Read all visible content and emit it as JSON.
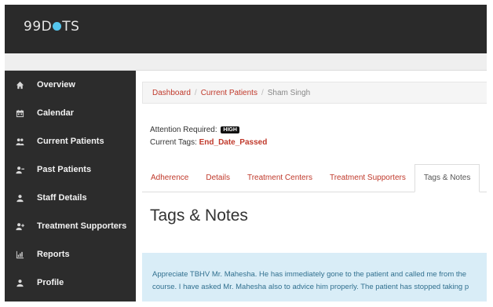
{
  "app": {
    "brand_prefix": "99D",
    "brand_suffix": "TS",
    "logo_dot_color": "#55c6ee"
  },
  "sidebar": {
    "items": [
      {
        "label": "Overview",
        "icon": "home-icon"
      },
      {
        "label": "Calendar",
        "icon": "calendar-icon"
      },
      {
        "label": "Current Patients",
        "icon": "users-icon"
      },
      {
        "label": "Past Patients",
        "icon": "user-minus-icon"
      },
      {
        "label": "Staff Details",
        "icon": "user-icon"
      },
      {
        "label": "Treatment Supporters",
        "icon": "user-plus-icon"
      },
      {
        "label": "Reports",
        "icon": "bar-chart-icon"
      },
      {
        "label": "Profile",
        "icon": "user-icon"
      }
    ]
  },
  "breadcrumb": {
    "items": [
      "Dashboard",
      "Current Patients"
    ],
    "current": "Sham Singh",
    "separator": "/"
  },
  "attention": {
    "label": "Attention Required:",
    "badge": "HIGH"
  },
  "tags": {
    "label": "Current Tags:",
    "value": "End_Date_Passed"
  },
  "tabs": [
    {
      "label": "Adherence",
      "active": false
    },
    {
      "label": "Details",
      "active": false
    },
    {
      "label": "Treatment Centers",
      "active": false
    },
    {
      "label": "Treatment Supporters",
      "active": false
    },
    {
      "label": "Tags & Notes",
      "active": true
    }
  ],
  "page_title": "Tags & Notes",
  "note": {
    "line1": "Appreciate TBHV Mr. Mahesha. He has immediately gone to the patient and called me from the",
    "line2": "course. I have asked Mr. Mahesha also to advice him properly. The patient has stopped taking p"
  },
  "colors": {
    "accent": "#c0392b",
    "sidebar_bg": "#2c2c2c",
    "topbar_bg": "#2a2a2a",
    "note_bg": "#d9edf7"
  }
}
